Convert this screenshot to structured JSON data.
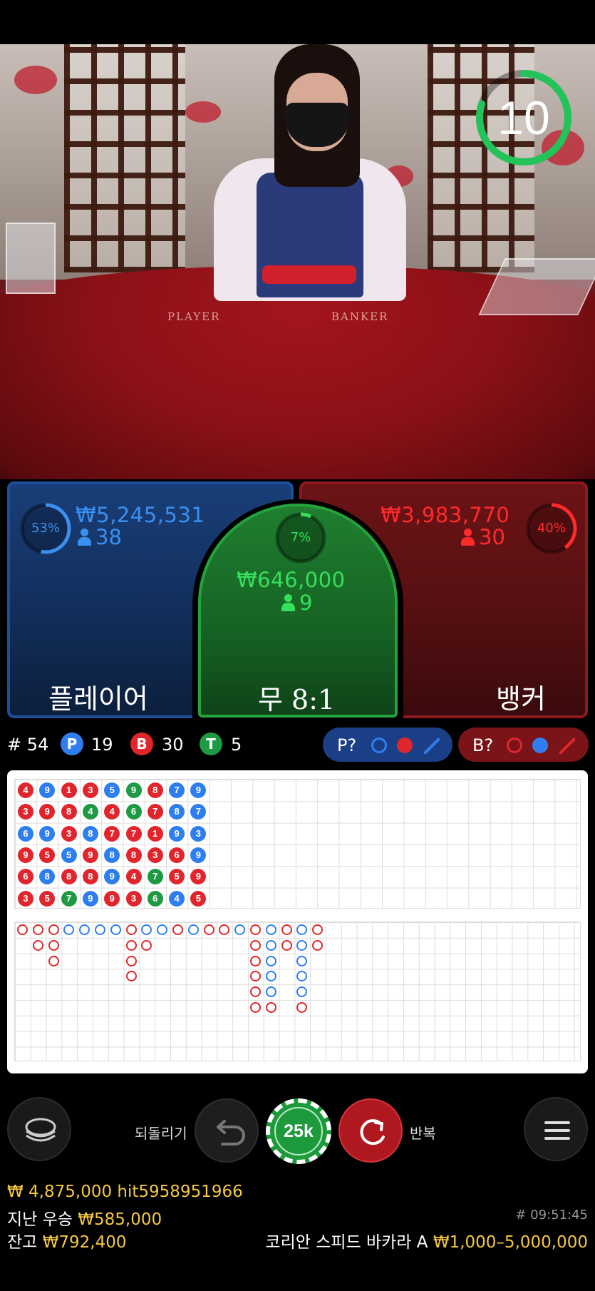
{
  "timer": {
    "seconds": "10",
    "progress": 0.8,
    "color": "#22c45a"
  },
  "felt": {
    "player_text": "PLAYER",
    "banker_text": "BANKER"
  },
  "player": {
    "percent": "53%",
    "percent_value": 0.53,
    "amount": "₩5,245,531",
    "bettors": "38",
    "label": "플레이어",
    "color": "#3a8ff0"
  },
  "tie": {
    "percent": "7%",
    "percent_value": 0.07,
    "amount": "₩646,000",
    "bettors": "9",
    "label": "무 8:1",
    "color": "#35e05a"
  },
  "banker": {
    "percent": "40%",
    "percent_value": 0.4,
    "amount": "₩3,983,770",
    "bettors": "30",
    "label": "뱅커",
    "color": "#ff2a2a"
  },
  "stats": {
    "round": "# 54",
    "player_badge": "P",
    "player_count": "19",
    "banker_badge": "B",
    "banker_count": "30",
    "tie_badge": "T",
    "tie_count": "5",
    "player_predict_label": "P?",
    "banker_predict_label": "B?"
  },
  "bead_road": [
    [
      "4R",
      "3R",
      "6B",
      "9R",
      "6R",
      "3R"
    ],
    [
      "9B",
      "9R",
      "9B",
      "5R",
      "8B",
      "5R"
    ],
    [
      "1R",
      "8R",
      "3R",
      "5B",
      "8R",
      "7G"
    ],
    [
      "3R",
      "4G",
      "8B",
      "9R",
      "8R",
      "9B"
    ],
    [
      "5B",
      "4R",
      "7R",
      "8B",
      "9B",
      "9R"
    ],
    [
      "9G",
      "6G",
      "7R",
      "8R",
      "4R",
      "3R"
    ],
    [
      "8R",
      "7R",
      "1R",
      "3R",
      "7G",
      "6G"
    ],
    [
      "7B",
      "8B",
      "9B",
      "6R",
      "5R",
      "4B"
    ],
    [
      "9B",
      "7B",
      "3B",
      "9B",
      "9R",
      "5R"
    ]
  ],
  "big_road": [
    [
      "R"
    ],
    [
      "R",
      "R"
    ],
    [
      "R",
      "R",
      "R"
    ],
    [
      "B"
    ],
    [
      "B"
    ],
    [
      "B"
    ],
    [
      "B"
    ],
    [
      "R",
      "R",
      "R",
      "R"
    ],
    [
      "B",
      "R"
    ],
    [
      "B"
    ],
    [
      "R"
    ],
    [
      "B"
    ],
    [
      "R"
    ],
    [
      "R"
    ],
    [
      "B"
    ],
    [
      "R",
      "R",
      "R",
      "R",
      "R",
      "R"
    ],
    [
      "B",
      "B",
      "B",
      "B",
      "B",
      "R"
    ],
    [
      "R",
      "R"
    ],
    [
      "B",
      "B",
      "B",
      "B",
      "B",
      "R"
    ],
    [
      "R",
      "R"
    ]
  ],
  "controls": {
    "undo_label": "되돌리기",
    "repeat_label": "반복",
    "chip_value": "25k"
  },
  "footer": {
    "top_win": "₩ 4,875,000 hit5958951966",
    "last_win_label": "지난 우승",
    "last_win_amount": "₩585,000",
    "balance_label": "잔고",
    "balance_amount": "₩792,400",
    "time": "# 09:51:45",
    "table_name": "코리안 스피드 바카라 A",
    "limits": "₩1,000–5,000,000"
  }
}
